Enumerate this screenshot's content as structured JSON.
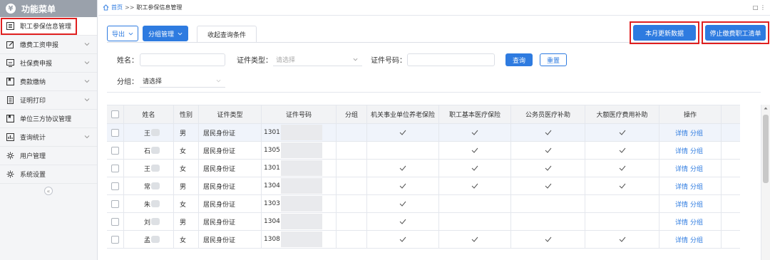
{
  "sidebar": {
    "header": "功能菜单",
    "header_icon": "yen-icon",
    "items": [
      {
        "label": "职工参保信息管理",
        "icon": "list-icon",
        "active": true,
        "expandable": false
      },
      {
        "label": "缴费工资申报",
        "icon": "edit-icon",
        "active": false,
        "expandable": true
      },
      {
        "label": "社保费申报",
        "icon": "monitor-icon",
        "active": false,
        "expandable": true
      },
      {
        "label": "费款缴纳",
        "icon": "bookmark-icon",
        "active": false,
        "expandable": true
      },
      {
        "label": "证明打印",
        "icon": "document-icon",
        "active": false,
        "expandable": true
      },
      {
        "label": "单位三方协议管理",
        "icon": "bookmark-icon",
        "active": false,
        "expandable": false
      },
      {
        "label": "查询统计",
        "icon": "chart-icon",
        "active": false,
        "expandable": true
      },
      {
        "label": "用户管理",
        "icon": "gear-icon",
        "active": false,
        "expandable": false
      },
      {
        "label": "系统设置",
        "icon": "gear-icon",
        "active": false,
        "expandable": false
      }
    ],
    "collapse_glyph": "«"
  },
  "breadcrumb": {
    "home": "首页",
    "separator": ">>",
    "current": "职工参保信息管理"
  },
  "toolbar": {
    "export_label": "导出",
    "group_label": "分组管理",
    "collapse_tab_label": "收起查询条件",
    "update_label": "本月更新数据",
    "stop_label": "停止缴费职工清单"
  },
  "search": {
    "name_label": "姓名：",
    "name_value": "",
    "id_type_label": "证件类型：",
    "id_type_placeholder": "请选择",
    "id_no_label": "证件号码：",
    "id_no_value": "",
    "group_label": "分组：",
    "group_value": "请选择",
    "query_label": "查询",
    "reset_label": "重置"
  },
  "table": {
    "headers": [
      "姓名",
      "性别",
      "证件类型",
      "证件号码",
      "分组",
      "机关事业单位养老保险",
      "职工基本医疗保险",
      "公务员医疗补助",
      "大额医疗费用补助",
      "操作"
    ],
    "rows": [
      {
        "name": "王",
        "gender": "男",
        "id_type": "居民身份证",
        "id_no": "1301",
        "group": "",
        "pension": true,
        "medical": true,
        "civil": true,
        "large": true
      },
      {
        "name": "石",
        "gender": "女",
        "id_type": "居民身份证",
        "id_no": "1305",
        "group": "",
        "pension": false,
        "medical": true,
        "civil": true,
        "large": true
      },
      {
        "name": "王",
        "gender": "女",
        "id_type": "居民身份证",
        "id_no": "1301",
        "group": "",
        "pension": true,
        "medical": true,
        "civil": true,
        "large": true
      },
      {
        "name": "常",
        "gender": "男",
        "id_type": "居民身份证",
        "id_no": "1304",
        "group": "",
        "pension": true,
        "medical": true,
        "civil": true,
        "large": true
      },
      {
        "name": "朱",
        "gender": "女",
        "id_type": "居民身份证",
        "id_no": "1303",
        "group": "",
        "pension": true,
        "medical": false,
        "civil": false,
        "large": false
      },
      {
        "name": "刘",
        "gender": "男",
        "id_type": "居民身份证",
        "id_no": "1304",
        "group": "",
        "pension": true,
        "medical": false,
        "civil": false,
        "large": false
      },
      {
        "name": "孟",
        "gender": "女",
        "id_type": "居民身份证",
        "id_no": "1308",
        "group": "",
        "pension": true,
        "medical": true,
        "civil": true,
        "large": true
      }
    ],
    "action_detail": "详情",
    "action_group": "分组"
  },
  "window_controls": "□ ⋮",
  "colors": {
    "primary": "#2e7be0",
    "highlight_red": "#e02020",
    "sidebar_header": "#9aa1ab"
  }
}
